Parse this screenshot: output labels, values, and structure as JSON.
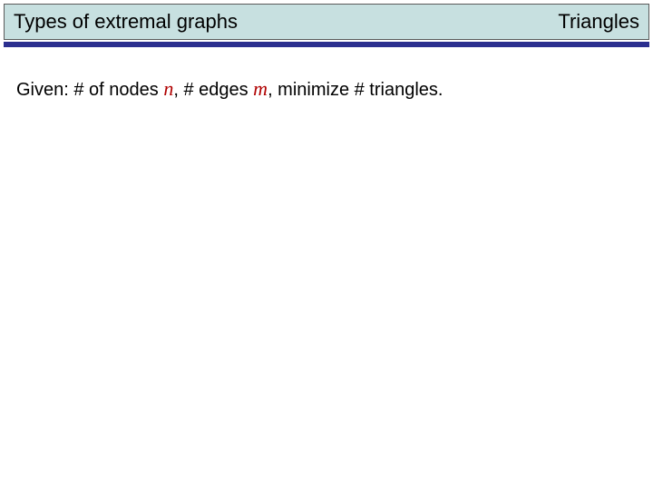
{
  "header": {
    "left": "Types of extremal graphs",
    "right": "Triangles"
  },
  "body": {
    "part1": "Given: # of nodes ",
    "var_n": "n",
    "part2": ", # edges ",
    "var_m": "m",
    "part3": ", minimize # triangles."
  }
}
